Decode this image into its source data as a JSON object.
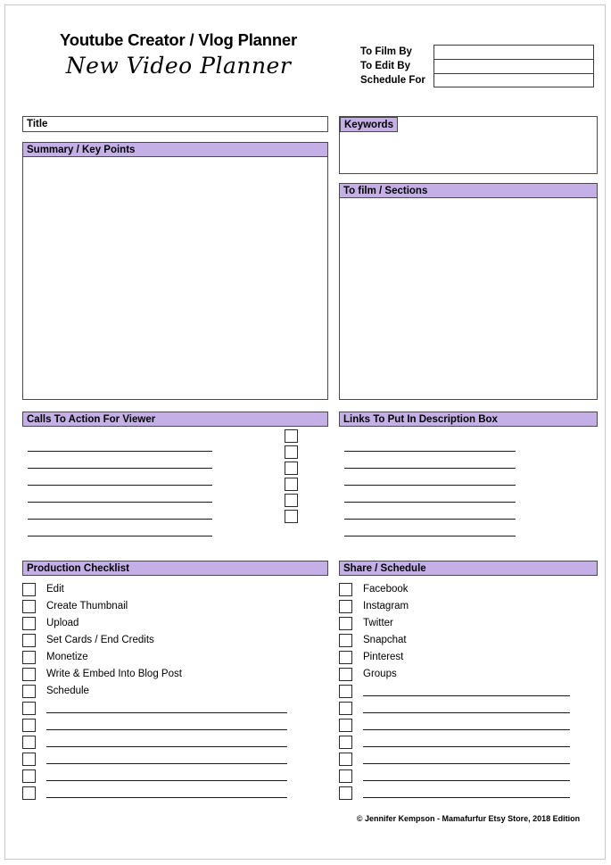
{
  "document": {
    "title_main": "Youtube Creator / Vlog Planner",
    "title_script": "New Video Planner",
    "footer": "© Jennifer Kempson - Mamafurfur Etsy Store, 2018 Edition",
    "accent_color": "#c4afe7",
    "border_color": "#4a4a4a",
    "rule_color": "#1a1a1a"
  },
  "dates": {
    "rows": [
      {
        "label": "To Film By",
        "value": ""
      },
      {
        "label": "To Edit By",
        "value": ""
      },
      {
        "label": "Schedule For",
        "value": ""
      }
    ]
  },
  "title_field": {
    "label": "Title",
    "value": ""
  },
  "keywords": {
    "label": "Keywords",
    "value": ""
  },
  "summary": {
    "label": "Summary / Key Points",
    "value": ""
  },
  "to_film": {
    "label": "To film / Sections",
    "value": ""
  },
  "calls_to_action": {
    "label": "Calls To Action For Viewer",
    "line_count": 6,
    "checkbox_count": 6,
    "lines": [
      "",
      "",
      "",
      "",
      "",
      ""
    ]
  },
  "links": {
    "label": "Links To Put In Description Box",
    "line_count": 6,
    "lines": [
      "",
      "",
      "",
      "",
      "",
      ""
    ]
  },
  "production_checklist": {
    "label": "Production Checklist",
    "items": [
      {
        "label": "Edit",
        "checked": false
      },
      {
        "label": "Create Thumbnail",
        "checked": false
      },
      {
        "label": "Upload",
        "checked": false
      },
      {
        "label": "Set Cards / End Credits",
        "checked": false
      },
      {
        "label": "Monetize",
        "checked": false
      },
      {
        "label": "Write & Embed Into Blog Post",
        "checked": false
      },
      {
        "label": "Schedule",
        "checked": false
      }
    ],
    "blank_rows": 6
  },
  "share_schedule": {
    "label": "Share / Schedule",
    "items": [
      {
        "label": "Facebook",
        "checked": false
      },
      {
        "label": "Instagram",
        "checked": false
      },
      {
        "label": "Twitter",
        "checked": false
      },
      {
        "label": "Snapchat",
        "checked": false
      },
      {
        "label": "Pinterest",
        "checked": false
      },
      {
        "label": "Groups",
        "checked": false
      }
    ],
    "blank_rows": 7
  }
}
